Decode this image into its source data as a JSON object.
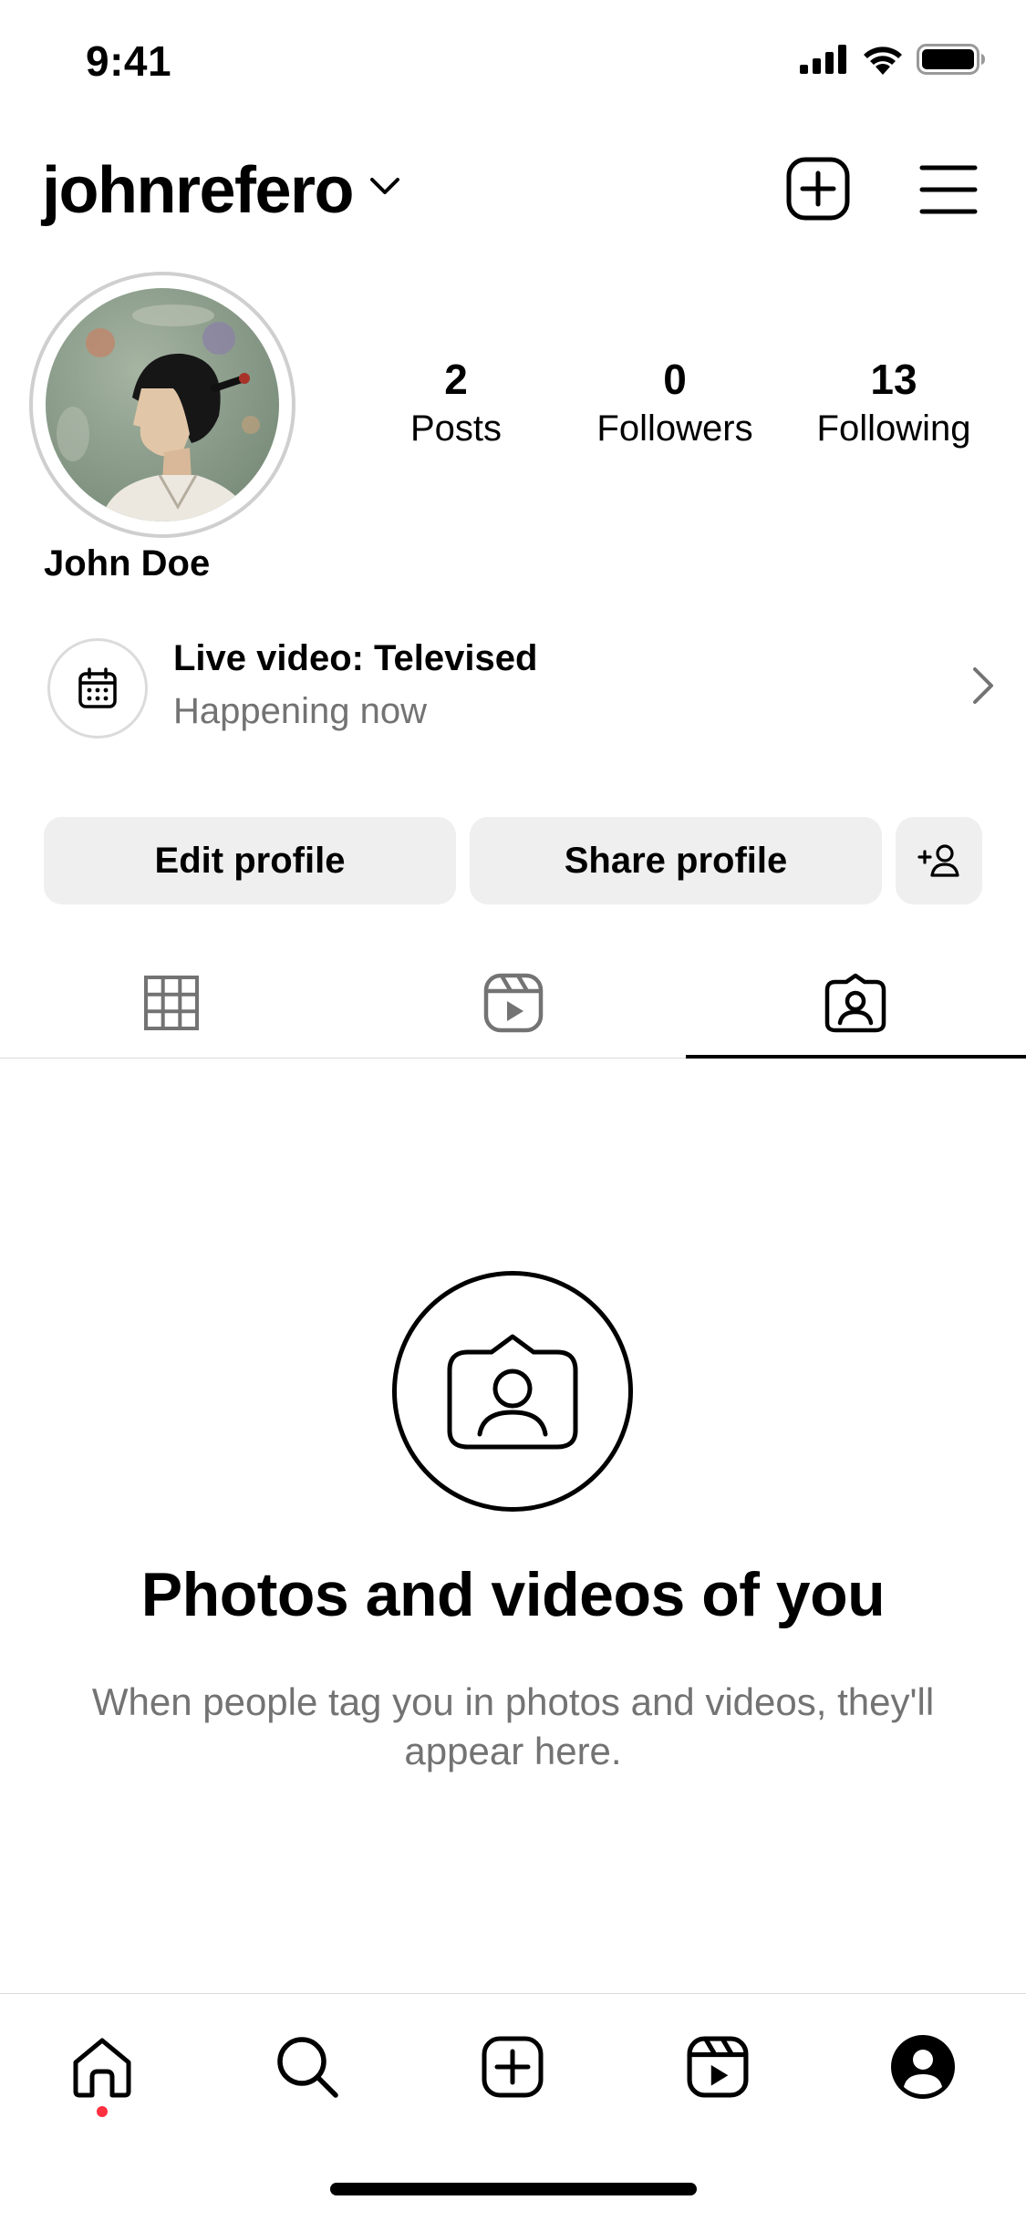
{
  "status_bar": {
    "time": "9:41"
  },
  "header": {
    "username": "johnrefero",
    "icons": {
      "dropdown": "chevron-down-icon",
      "new_post": "plus-square-icon",
      "menu": "hamburger-menu-icon"
    }
  },
  "profile": {
    "display_name": "John Doe",
    "stats": [
      {
        "value": "2",
        "label": "Posts"
      },
      {
        "value": "0",
        "label": "Followers"
      },
      {
        "value": "13",
        "label": "Following"
      }
    ]
  },
  "live": {
    "title": "Live video: Televised",
    "subtitle": "Happening now",
    "icon": "calendar-icon"
  },
  "actions": {
    "edit_label": "Edit profile",
    "share_label": "Share profile",
    "add_icon": "add-person-icon"
  },
  "tabs": [
    {
      "name": "posts-grid",
      "icon": "grid-icon",
      "active": false
    },
    {
      "name": "reels",
      "icon": "reels-icon",
      "active": false
    },
    {
      "name": "tagged",
      "icon": "tagged-person-icon",
      "active": true
    }
  ],
  "empty_state": {
    "title": "Photos and videos of you",
    "subtitle": "When people tag you in photos and videos, they'll appear here."
  },
  "bottom_nav": [
    {
      "name": "home",
      "icon": "home-icon",
      "has_notification": true
    },
    {
      "name": "search",
      "icon": "search-icon"
    },
    {
      "name": "create",
      "icon": "plus-square-icon"
    },
    {
      "name": "reels",
      "icon": "reels-icon"
    },
    {
      "name": "profile",
      "icon": "profile-icon"
    }
  ],
  "colors": {
    "background": "#ffffff",
    "button_bg": "#efefef",
    "secondary_text": "#737373",
    "divider": "#dbdbdb",
    "notification": "#ff3040"
  }
}
